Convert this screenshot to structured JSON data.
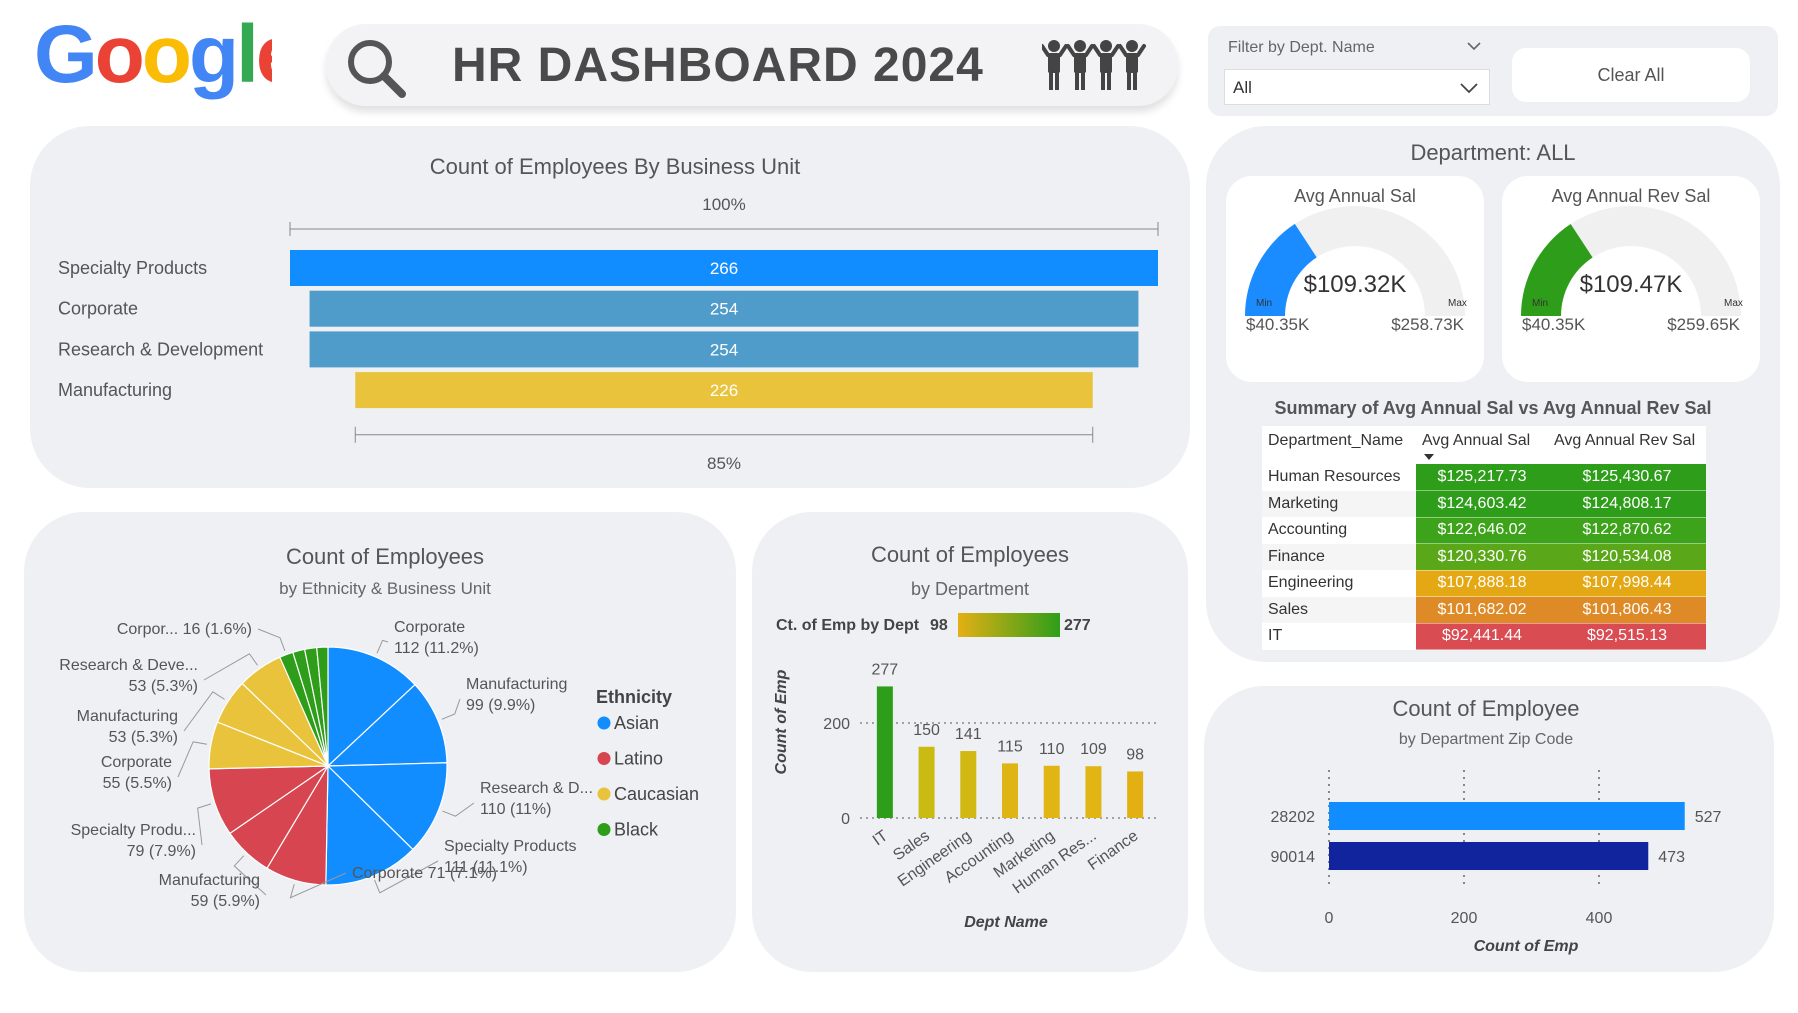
{
  "header": {
    "logo_text": "Google",
    "title": "HR DASHBOARD 2024",
    "search_icon": "search-icon",
    "people_icon": "people-icon"
  },
  "filter": {
    "label": "Filter by Dept. Name",
    "value": "All",
    "clear_label": "Clear All"
  },
  "department_panel": {
    "title": "Department: ALL",
    "gauges": [
      {
        "title": "Avg Annual Sal",
        "value_label": "$109.32K",
        "value": 109.32,
        "min": 40.35,
        "max": 258.73,
        "min_label": "$40.35K",
        "max_label": "$258.73K",
        "color": "#1a8cff",
        "min_tag": "Min",
        "max_tag": "Max"
      },
      {
        "title": "Avg Annual Rev Sal",
        "value_label": "$109.47K",
        "value": 109.47,
        "min": 40.35,
        "max": 259.65,
        "min_label": "$40.35K",
        "max_label": "$259.65K",
        "color": "#2e9e1a",
        "min_tag": "Min",
        "max_tag": "Max"
      }
    ],
    "summary": {
      "title": "Summary of Avg Annual Sal vs Avg Annual Rev Sal",
      "headers": [
        "Department_Name",
        "Avg Annual Sal",
        "Avg Annual Rev Sal"
      ],
      "rows": [
        {
          "name": "Human Resources",
          "sal": "$125,217.73",
          "rev": "$125,430.67",
          "color": "#2e9e1a"
        },
        {
          "name": "Marketing",
          "sal": "$124,603.42",
          "rev": "$124,808.17",
          "color": "#2e9e1a"
        },
        {
          "name": "Accounting",
          "sal": "$122,646.02",
          "rev": "$122,870.62",
          "color": "#3da31a"
        },
        {
          "name": "Finance",
          "sal": "$120,330.76",
          "rev": "$120,534.08",
          "color": "#5aa819"
        },
        {
          "name": "Engineering",
          "sal": "$107,888.18",
          "rev": "$107,998.44",
          "color": "#e3a814"
        },
        {
          "name": "Sales",
          "sal": "$101,682.02",
          "rev": "$101,806.43",
          "color": "#de8a26"
        },
        {
          "name": "IT",
          "sal": "$92,441.44",
          "rev": "$92,515.13",
          "color": "#d84c52"
        }
      ]
    }
  },
  "chart_data": [
    {
      "type": "funnel",
      "title": "Count of Employees By Business Unit",
      "top_label": "100%",
      "bottom_label": "85%",
      "categories": [
        "Specialty Products",
        "Corporate",
        "Research & Development",
        "Manufacturing"
      ],
      "values": [
        266,
        254,
        254,
        226
      ],
      "colors": [
        "#118dff",
        "#4f9ccb",
        "#4f9ccb",
        "#e9c33b"
      ]
    },
    {
      "type": "pie",
      "title": "Count of Employees",
      "subtitle": "by Ethnicity & Business Unit",
      "legend_title": "Ethnicity",
      "legend": [
        {
          "name": "Asian",
          "color": "#118dff"
        },
        {
          "name": "Latino",
          "color": "#d64550"
        },
        {
          "name": "Caucasian",
          "color": "#e9c33b"
        },
        {
          "name": "Black",
          "color": "#2e9e1a"
        }
      ],
      "slices": [
        {
          "label": "Corporate",
          "detail": "112 (11.2%)",
          "value": 112,
          "group": "Asian"
        },
        {
          "label": "Manufacturing",
          "detail": "99 (9.9%)",
          "value": 99,
          "group": "Asian"
        },
        {
          "label": "Research & D...",
          "detail": "110 (11%)",
          "value": 110,
          "group": "Asian"
        },
        {
          "label": "Specialty Products",
          "detail": "111 (11.1%)",
          "value": 111,
          "group": "Asian"
        },
        {
          "label": "Corporate 71 (7.1%)",
          "detail": "",
          "value": 71,
          "group": "Latino"
        },
        {
          "label": "Manufacturing",
          "detail": "59 (5.9%)",
          "value": 59,
          "group": "Latino"
        },
        {
          "label": "Specialty Produ...",
          "detail": "79 (7.9%)",
          "value": 79,
          "group": "Latino"
        },
        {
          "label": "Corporate",
          "detail": "55 (5.5%)",
          "value": 55,
          "group": "Caucasian"
        },
        {
          "label": "Manufacturing",
          "detail": "53 (5.3%)",
          "value": 53,
          "group": "Caucasian"
        },
        {
          "label": "Research & Deve...",
          "detail": "53 (5.3%)",
          "value": 53,
          "group": "Caucasian"
        },
        {
          "label": "Corpor... 16 (1.6%)",
          "detail": "",
          "value": 16,
          "group": "Black"
        },
        {
          "label": "",
          "detail": "",
          "value": 14,
          "group": "Black"
        },
        {
          "label": "",
          "detail": "",
          "value": 14,
          "group": "Black"
        },
        {
          "label": "",
          "detail": "",
          "value": 13,
          "group": "Black"
        }
      ]
    },
    {
      "type": "bar",
      "title": "Count of Employees",
      "subtitle": "by Department",
      "legend_label": "Ct. of Emp by Dept",
      "legend_min": "98",
      "legend_max": "277",
      "categories": [
        "IT",
        "Sales",
        "Engineering",
        "Accounting",
        "Marketing",
        "Human Res...",
        "Finance"
      ],
      "values": [
        277,
        150,
        141,
        115,
        110,
        109,
        98
      ],
      "colors": [
        "#2e9e1a",
        "#c9bb12",
        "#d1b812",
        "#dfb514",
        "#e0b514",
        "#e0b514",
        "#e3b014"
      ],
      "ylabel": "Count of Emp",
      "xlabel": "Dept Name",
      "yticks": [
        0,
        200
      ],
      "ylim": [
        0,
        300
      ]
    },
    {
      "type": "bar-horizontal",
      "title": "Count of Employee",
      "subtitle": "by Department Zip Code",
      "categories": [
        "28202",
        "90014"
      ],
      "values": [
        527,
        473
      ],
      "colors": [
        "#118dff",
        "#12239e"
      ],
      "xlabel": "Count of Emp",
      "xticks": [
        0,
        200,
        400
      ],
      "xlim": [
        0,
        530
      ]
    }
  ]
}
